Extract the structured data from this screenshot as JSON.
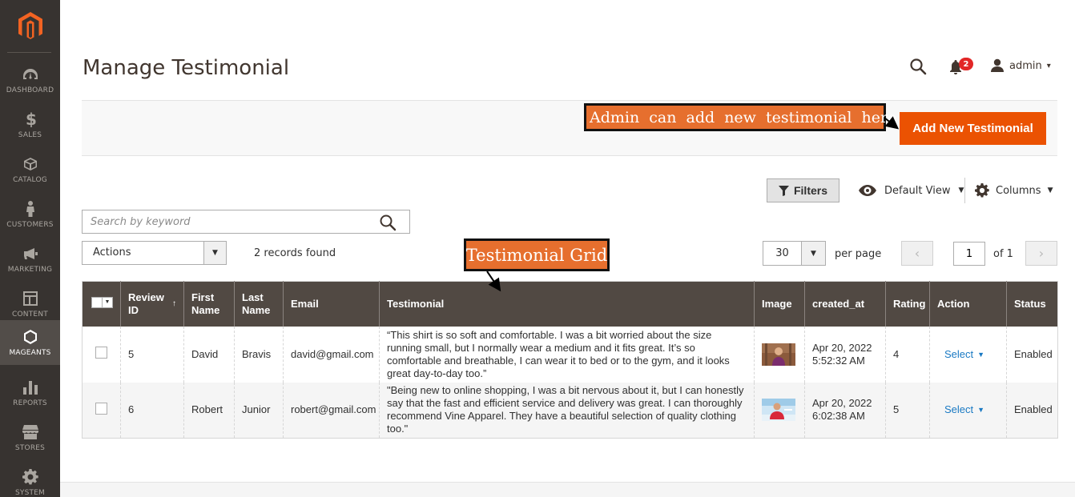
{
  "sidebar": {
    "items": [
      {
        "label": "DASHBOARD",
        "icon": "dashboard-icon"
      },
      {
        "label": "SALES",
        "icon": "dollar-icon"
      },
      {
        "label": "CATALOG",
        "icon": "box-icon"
      },
      {
        "label": "CUSTOMERS",
        "icon": "person-icon"
      },
      {
        "label": "MARKETING",
        "icon": "megaphone-icon"
      },
      {
        "label": "CONTENT",
        "icon": "layout-icon"
      },
      {
        "label": "MAGEANTS",
        "icon": "hexagon-icon"
      },
      {
        "label": "REPORTS",
        "icon": "bar-chart-icon"
      },
      {
        "label": "STORES",
        "icon": "store-icon"
      },
      {
        "label": "SYSTEM",
        "icon": "gear-icon"
      }
    ],
    "active": "MAGEANTS"
  },
  "header": {
    "title": "Manage Testimonial",
    "notifications": "2",
    "user": "admin"
  },
  "actionbar": {
    "add_label": "Add New Testimonial"
  },
  "annotations": {
    "add_callout": "Admin can add new testimonial here",
    "grid_callout": "Testimonial Grid"
  },
  "toolbar": {
    "filters": "Filters",
    "view": "Default View",
    "columns": "Columns",
    "search_placeholder": "Search by keyword",
    "actions": "Actions",
    "records": "2 records found",
    "per_page_value": "30",
    "per_page_label": "per page",
    "page": "1",
    "of_label": "of 1"
  },
  "grid": {
    "headers": {
      "review_id_1": "Review",
      "review_id_2": "ID",
      "first_name_1": "First",
      "first_name_2": "Name",
      "last_name_1": "Last",
      "last_name_2": "Name",
      "email": "Email",
      "testimonial": "Testimonial",
      "image": "Image",
      "created_at": "created_at",
      "rating": "Rating",
      "action": "Action",
      "status": "Status"
    },
    "rows": [
      {
        "id": "5",
        "first": "David",
        "last": "Bravis",
        "email": "david@gmail.com",
        "testimonial": "“This shirt is so soft and comfortable. I was a bit worried about the size running small, but I normally wear a medium and it fits great. It’s so comfortable and breathable, I can wear it to bed or to the gym, and it looks great day-to-day too.”",
        "date": "Apr 20, 2022",
        "time": "5:52:32 AM",
        "rating": "4",
        "action": "Select",
        "status": "Enabled"
      },
      {
        "id": "6",
        "first": "Robert",
        "last": "Junior",
        "email": "robert@gmail.com",
        "testimonial": "\"Being new to online shopping, I was a bit nervous about it, but I can honestly say that the fast and efficient service and delivery was great. I can thoroughly recommend Vine Apparel. They have a beautiful selection of quality clothing too.\"",
        "date": "Apr 20, 2022",
        "time": "6:02:38 AM",
        "rating": "5",
        "action": "Select",
        "status": "Enabled"
      }
    ]
  },
  "colors": {
    "sidebar": "#373330",
    "accent": "#eb5202",
    "grid_header": "#514943",
    "link": "#1979c3",
    "callout": "#e66f2e"
  }
}
